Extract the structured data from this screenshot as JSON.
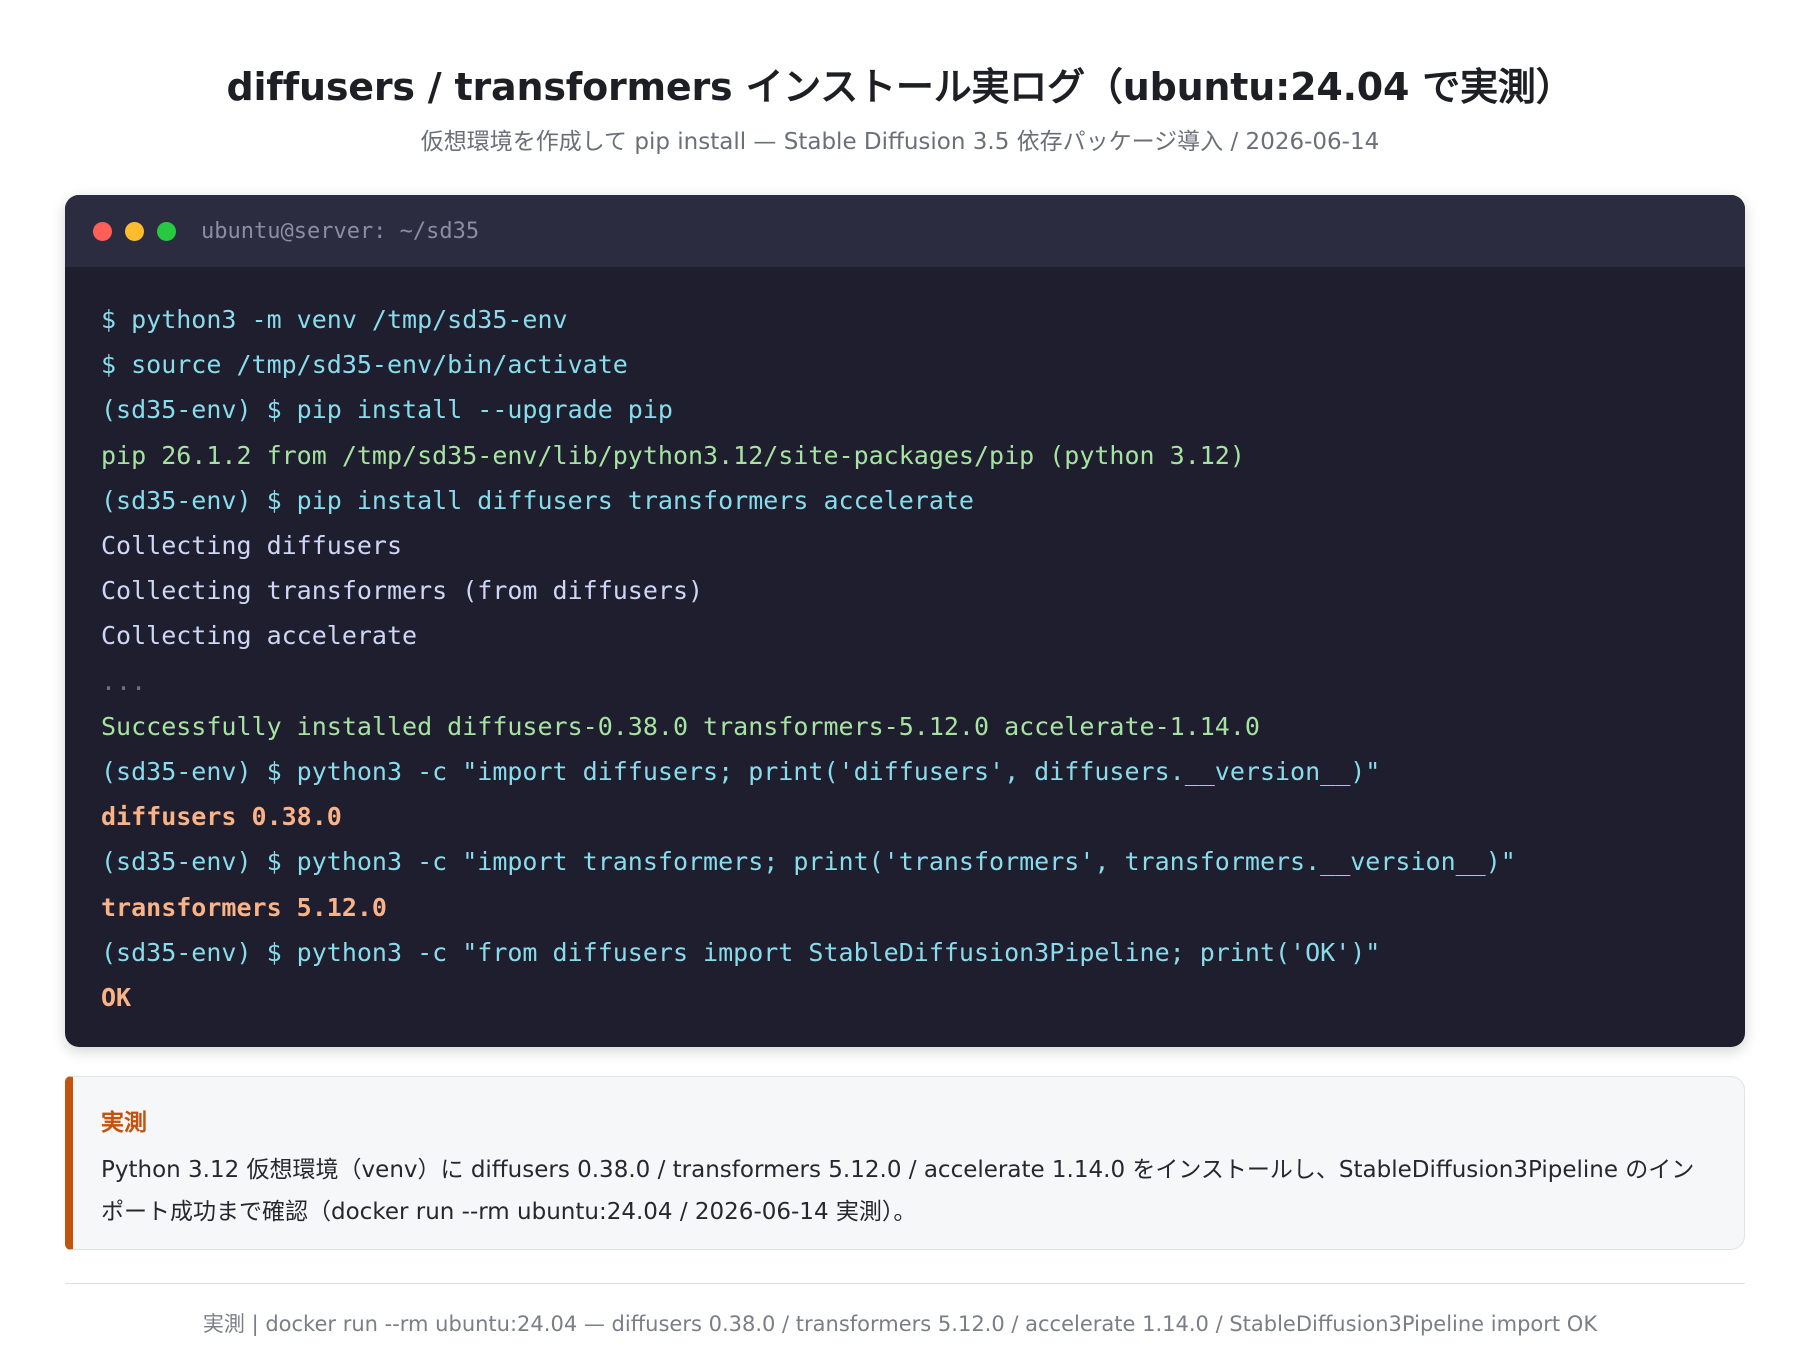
{
  "header": {
    "title": "diffusers / transformers インストール実ログ（ubuntu:24.04 で実測）",
    "subtitle": "仮想環境を作成して pip install — Stable Diffusion 3.5 依存パッケージ導入 / 2026-06-14"
  },
  "terminal": {
    "title": "ubuntu@server: ~/sd35",
    "lines": [
      {
        "kind": "cmd",
        "text": "$ python3 -m venv /tmp/sd35-env"
      },
      {
        "kind": "cmd",
        "text": "$ source /tmp/sd35-env/bin/activate"
      },
      {
        "kind": "cmd",
        "text": "(sd35-env) $ pip install --upgrade pip"
      },
      {
        "kind": "info",
        "text": "pip 26.1.2 from /tmp/sd35-env/lib/python3.12/site-packages/pip (python 3.12)"
      },
      {
        "kind": "cmd",
        "text": "(sd35-env) $ pip install diffusers transformers accelerate"
      },
      {
        "kind": "out",
        "text": "Collecting diffusers"
      },
      {
        "kind": "out",
        "text": "Collecting transformers (from diffusers)"
      },
      {
        "kind": "out",
        "text": "Collecting accelerate"
      },
      {
        "kind": "dim",
        "text": "..."
      },
      {
        "kind": "ok",
        "text": "Successfully installed diffusers-0.38.0 transformers-5.12.0 accelerate-1.14.0"
      },
      {
        "kind": "cmd",
        "text": "(sd35-env) $ python3 -c \"import diffusers; print('diffusers', diffusers.__version__)\""
      },
      {
        "kind": "res",
        "text": "diffusers 0.38.0"
      },
      {
        "kind": "cmd",
        "text": "(sd35-env) $ python3 -c \"import transformers; print('transformers', transformers.__version__)\""
      },
      {
        "kind": "res",
        "text": "transformers 5.12.0"
      },
      {
        "kind": "cmd",
        "text": "(sd35-env) $ python3 -c \"from diffusers import StableDiffusion3Pipeline; print('OK')\""
      },
      {
        "kind": "res",
        "text": "OK"
      }
    ]
  },
  "note": {
    "label": "実測",
    "text": "Python 3.12 仮想環境（venv）に diffusers 0.38.0 / transformers 5.12.0 / accelerate 1.14.0 をインストールし、StableDiffusion3Pipeline のインポート成功まで確認（docker run --rm ubuntu:24.04 / 2026-06-14 実測）。"
  },
  "footer": {
    "text": "実測 | docker run --rm ubuntu:24.04 — diffusers 0.38.0 / transformers 5.12.0 / accelerate 1.14.0 / StableDiffusion3Pipeline import OK"
  },
  "colors": {
    "terminal_bg": "#1e1e2e",
    "titlebar_bg": "#2b2c3f",
    "command": "#89dceb",
    "info": "#a6e3a1",
    "output": "#cdd6f4",
    "result": "#fab387",
    "accent": "#c2530f"
  }
}
